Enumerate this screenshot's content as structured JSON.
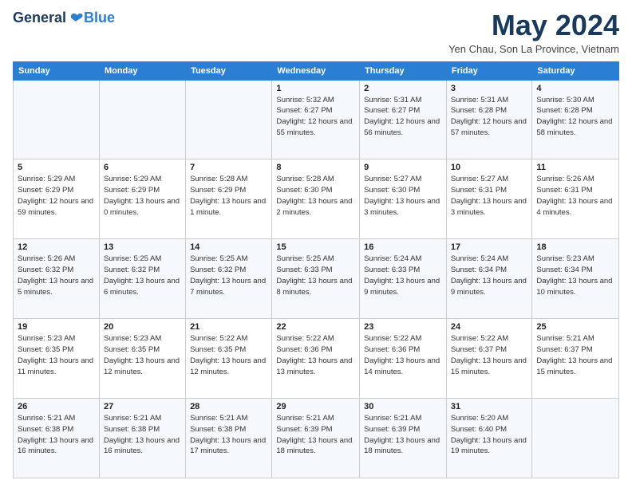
{
  "logo": {
    "general": "General",
    "blue": "Blue"
  },
  "title": "May 2024",
  "location": "Yen Chau, Son La Province, Vietnam",
  "days_of_week": [
    "Sunday",
    "Monday",
    "Tuesday",
    "Wednesday",
    "Thursday",
    "Friday",
    "Saturday"
  ],
  "weeks": [
    [
      {
        "day": "",
        "info": ""
      },
      {
        "day": "",
        "info": ""
      },
      {
        "day": "",
        "info": ""
      },
      {
        "day": "1",
        "info": "Sunrise: 5:32 AM\nSunset: 6:27 PM\nDaylight: 12 hours and 55 minutes."
      },
      {
        "day": "2",
        "info": "Sunrise: 5:31 AM\nSunset: 6:27 PM\nDaylight: 12 hours and 56 minutes."
      },
      {
        "day": "3",
        "info": "Sunrise: 5:31 AM\nSunset: 6:28 PM\nDaylight: 12 hours and 57 minutes."
      },
      {
        "day": "4",
        "info": "Sunrise: 5:30 AM\nSunset: 6:28 PM\nDaylight: 12 hours and 58 minutes."
      }
    ],
    [
      {
        "day": "5",
        "info": "Sunrise: 5:29 AM\nSunset: 6:29 PM\nDaylight: 12 hours and 59 minutes."
      },
      {
        "day": "6",
        "info": "Sunrise: 5:29 AM\nSunset: 6:29 PM\nDaylight: 13 hours and 0 minutes."
      },
      {
        "day": "7",
        "info": "Sunrise: 5:28 AM\nSunset: 6:29 PM\nDaylight: 13 hours and 1 minute."
      },
      {
        "day": "8",
        "info": "Sunrise: 5:28 AM\nSunset: 6:30 PM\nDaylight: 13 hours and 2 minutes."
      },
      {
        "day": "9",
        "info": "Sunrise: 5:27 AM\nSunset: 6:30 PM\nDaylight: 13 hours and 3 minutes."
      },
      {
        "day": "10",
        "info": "Sunrise: 5:27 AM\nSunset: 6:31 PM\nDaylight: 13 hours and 3 minutes."
      },
      {
        "day": "11",
        "info": "Sunrise: 5:26 AM\nSunset: 6:31 PM\nDaylight: 13 hours and 4 minutes."
      }
    ],
    [
      {
        "day": "12",
        "info": "Sunrise: 5:26 AM\nSunset: 6:32 PM\nDaylight: 13 hours and 5 minutes."
      },
      {
        "day": "13",
        "info": "Sunrise: 5:25 AM\nSunset: 6:32 PM\nDaylight: 13 hours and 6 minutes."
      },
      {
        "day": "14",
        "info": "Sunrise: 5:25 AM\nSunset: 6:32 PM\nDaylight: 13 hours and 7 minutes."
      },
      {
        "day": "15",
        "info": "Sunrise: 5:25 AM\nSunset: 6:33 PM\nDaylight: 13 hours and 8 minutes."
      },
      {
        "day": "16",
        "info": "Sunrise: 5:24 AM\nSunset: 6:33 PM\nDaylight: 13 hours and 9 minutes."
      },
      {
        "day": "17",
        "info": "Sunrise: 5:24 AM\nSunset: 6:34 PM\nDaylight: 13 hours and 9 minutes."
      },
      {
        "day": "18",
        "info": "Sunrise: 5:23 AM\nSunset: 6:34 PM\nDaylight: 13 hours and 10 minutes."
      }
    ],
    [
      {
        "day": "19",
        "info": "Sunrise: 5:23 AM\nSunset: 6:35 PM\nDaylight: 13 hours and 11 minutes."
      },
      {
        "day": "20",
        "info": "Sunrise: 5:23 AM\nSunset: 6:35 PM\nDaylight: 13 hours and 12 minutes."
      },
      {
        "day": "21",
        "info": "Sunrise: 5:22 AM\nSunset: 6:35 PM\nDaylight: 13 hours and 12 minutes."
      },
      {
        "day": "22",
        "info": "Sunrise: 5:22 AM\nSunset: 6:36 PM\nDaylight: 13 hours and 13 minutes."
      },
      {
        "day": "23",
        "info": "Sunrise: 5:22 AM\nSunset: 6:36 PM\nDaylight: 13 hours and 14 minutes."
      },
      {
        "day": "24",
        "info": "Sunrise: 5:22 AM\nSunset: 6:37 PM\nDaylight: 13 hours and 15 minutes."
      },
      {
        "day": "25",
        "info": "Sunrise: 5:21 AM\nSunset: 6:37 PM\nDaylight: 13 hours and 15 minutes."
      }
    ],
    [
      {
        "day": "26",
        "info": "Sunrise: 5:21 AM\nSunset: 6:38 PM\nDaylight: 13 hours and 16 minutes."
      },
      {
        "day": "27",
        "info": "Sunrise: 5:21 AM\nSunset: 6:38 PM\nDaylight: 13 hours and 16 minutes."
      },
      {
        "day": "28",
        "info": "Sunrise: 5:21 AM\nSunset: 6:38 PM\nDaylight: 13 hours and 17 minutes."
      },
      {
        "day": "29",
        "info": "Sunrise: 5:21 AM\nSunset: 6:39 PM\nDaylight: 13 hours and 18 minutes."
      },
      {
        "day": "30",
        "info": "Sunrise: 5:21 AM\nSunset: 6:39 PM\nDaylight: 13 hours and 18 minutes."
      },
      {
        "day": "31",
        "info": "Sunrise: 5:20 AM\nSunset: 6:40 PM\nDaylight: 13 hours and 19 minutes."
      },
      {
        "day": "",
        "info": ""
      }
    ]
  ]
}
